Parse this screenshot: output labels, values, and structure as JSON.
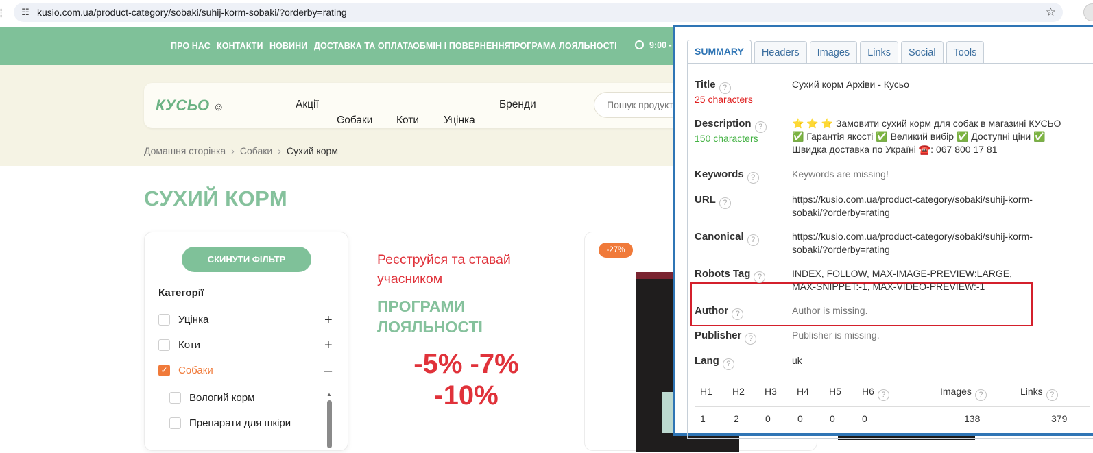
{
  "browser": {
    "url": "kusio.com.ua/product-category/sobaki/suhij-korm-sobaki/?orderby=rating"
  },
  "topnav": {
    "items": [
      "ПРО НАС",
      "КОНТАКТИ",
      "НОВИНИ",
      "ДОСТАВКА ТА ОПЛАТА",
      "ОБМІН І ПОВЕРНЕННЯ",
      "ПРОГРАМА ЛОЯЛЬНОСТІ"
    ],
    "hours": "9:00 -"
  },
  "header": {
    "logo": "КУСЬО",
    "menu": [
      "Акції",
      "Собаки",
      "Коти",
      "Уцінка",
      "Бренди"
    ],
    "search_placeholder": "Пошук продукт"
  },
  "breadcrumb": [
    "Домашня сторінка",
    "Собаки",
    "Сухий корм"
  ],
  "page_title": "СУХИЙ КОРМ",
  "filter": {
    "reset_label": "СКИНУТИ ФІЛЬТР",
    "heading": "Категорії",
    "items": [
      {
        "label": "Уцінка",
        "checked": false,
        "toggle": "+"
      },
      {
        "label": "Коти",
        "checked": false,
        "toggle": "+"
      },
      {
        "label": "Собаки",
        "checked": true,
        "toggle": "–"
      }
    ],
    "sub_items": [
      "Вологий корм",
      "Препарати для шкіри"
    ]
  },
  "promo": {
    "line1": "Реєструйся та ставай учасником",
    "line2": "ПРОГРАМИ ЛОЯЛЬНОСТІ",
    "discounts": "-5% -7% -10%"
  },
  "product": {
    "badge": "-27%"
  },
  "seo_panel": {
    "tabs": [
      "SUMMARY",
      "Headers",
      "Images",
      "Links",
      "Social",
      "Tools"
    ],
    "active_tab": "SUMMARY",
    "title": {
      "label": "Title",
      "count": "25 characters",
      "value": "Сухий корм Архіви - Кусьо"
    },
    "description": {
      "label": "Description",
      "count": "150 characters",
      "value": "⭐ ⭐ ⭐ Замовити сухий корм для собак в магазині КУСЬО ✅ Гарантія якості ✅ Великий вибір ✅ Доступні ціни ✅ Швидка доставка по Україні ☎️: 067 800 17 81"
    },
    "keywords": {
      "label": "Keywords",
      "value": "Keywords are missing!"
    },
    "url": {
      "label": "URL",
      "value": "https://kusio.com.ua/product-category/sobaki/suhij-korm-sobaki/?orderby=rating"
    },
    "canonical": {
      "label": "Canonical",
      "value": "https://kusio.com.ua/product-category/sobaki/suhij-korm-sobaki/?orderby=rating"
    },
    "robots": {
      "label": "Robots Tag",
      "value": "INDEX, FOLLOW, MAX-IMAGE-PREVIEW:LARGE, MAX-SNIPPET:-1, MAX-VIDEO-PREVIEW:-1"
    },
    "author": {
      "label": "Author",
      "value": "Author is missing."
    },
    "publisher": {
      "label": "Publisher",
      "value": "Publisher is missing."
    },
    "lang": {
      "label": "Lang",
      "value": "uk"
    },
    "headings_table": {
      "headers": [
        "H1",
        "H2",
        "H3",
        "H4",
        "H5",
        "H6",
        "Images",
        "Links"
      ],
      "values": [
        "1",
        "2",
        "0",
        "0",
        "0",
        "0",
        "138",
        "379"
      ]
    }
  }
}
